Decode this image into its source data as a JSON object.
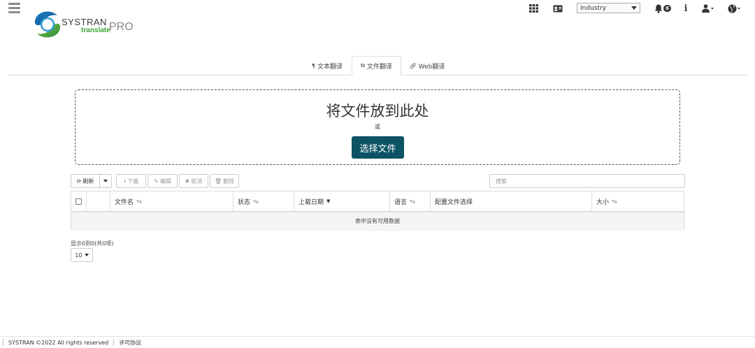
{
  "header": {
    "logo_brand": "SYSTRAN",
    "logo_sub": "translate",
    "logo_pro": "PRO",
    "industry_select": {
      "value": "Industry"
    },
    "notifications_count": "6",
    "icons": [
      "menu-icon",
      "apps-grid-icon",
      "contact-card-icon",
      "bell-icon",
      "info-icon",
      "user-icon",
      "globe-icon"
    ]
  },
  "tabs": [
    {
      "label": "文本翻译",
      "icon": "paragraph-icon",
      "active": false
    },
    {
      "label": "文件翻译",
      "icon": "copy-icon",
      "active": true
    },
    {
      "label": "Web翻译",
      "icon": "link-icon",
      "active": false
    }
  ],
  "dropzone": {
    "title": "将文件放到此处",
    "or": "或",
    "button": "选择文件"
  },
  "toolbar": {
    "refresh": "刷新",
    "download": "下载",
    "edit": "编辑",
    "cancel": "取消",
    "delete": "删除",
    "search_placeholder": "搜索"
  },
  "table": {
    "columns": [
      "文件名",
      "状态",
      "上载日期",
      "语言",
      "配置文件选择",
      "大小"
    ],
    "empty_message": "表中没有可用数据"
  },
  "pagination": {
    "info": "显示0到0(共0项)",
    "page_size": "10"
  },
  "footer": {
    "copyright": "SYSTRAN ©2022 All rights reserved",
    "license": "许可协议"
  },
  "colors": {
    "primary_button": "#0d5366",
    "logo_green": "#3fa535"
  }
}
